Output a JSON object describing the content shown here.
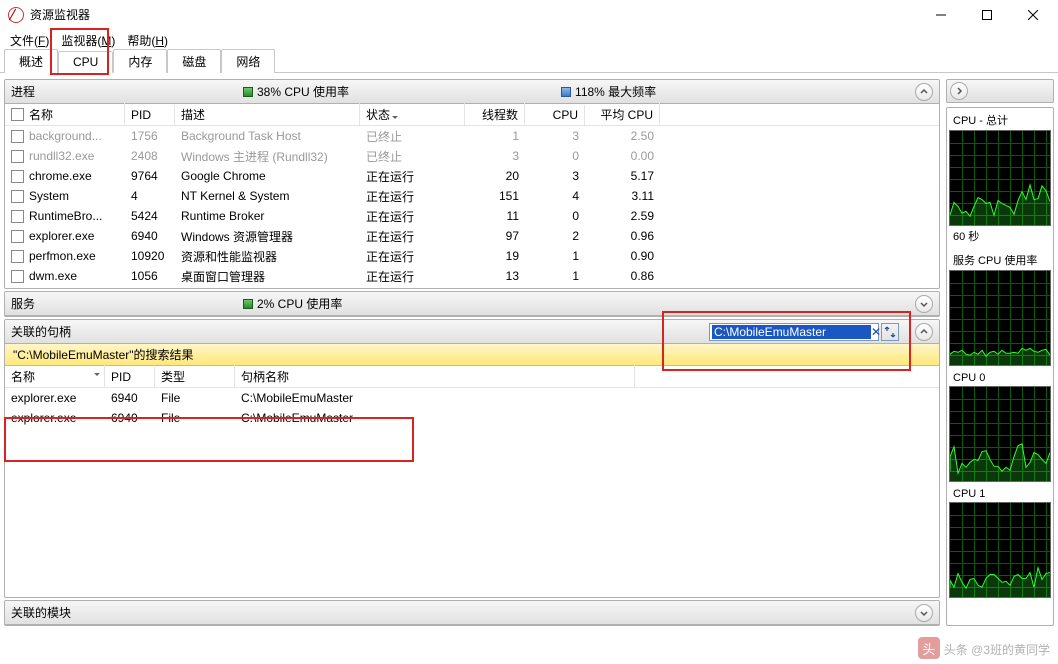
{
  "window": {
    "title": "资源监视器"
  },
  "menu": {
    "file": "文件(",
    "file_u": "F",
    "file2": ")",
    "monitor": "监视器(",
    "monitor_u": "M",
    "monitor2": ")",
    "help": "帮助(",
    "help_u": "H",
    "help2": ")"
  },
  "tabs": {
    "overview": "概述",
    "cpu": "CPU",
    "memory": "内存",
    "disk": "磁盘",
    "network": "网络"
  },
  "processes": {
    "title": "进程",
    "stat1": "38% CPU 使用率",
    "stat2": "118% 最大频率",
    "cols": {
      "name": "名称",
      "pid": "PID",
      "desc": "描述",
      "status": "状态",
      "threads": "线程数",
      "cpu": "CPU",
      "avgcpu": "平均 CPU"
    },
    "rows": [
      {
        "name": "background...",
        "pid": "1756",
        "desc": "Background Task Host",
        "status": "已终止",
        "threads": "1",
        "cpu": "3",
        "avg": "2.50",
        "gray": true
      },
      {
        "name": "rundll32.exe",
        "pid": "2408",
        "desc": "Windows 主进程 (Rundll32)",
        "status": "已终止",
        "threads": "3",
        "cpu": "0",
        "avg": "0.00",
        "gray": true
      },
      {
        "name": "chrome.exe",
        "pid": "9764",
        "desc": "Google Chrome",
        "status": "正在运行",
        "threads": "20",
        "cpu": "3",
        "avg": "5.17"
      },
      {
        "name": "System",
        "pid": "4",
        "desc": "NT Kernel & System",
        "status": "正在运行",
        "threads": "151",
        "cpu": "4",
        "avg": "3.11"
      },
      {
        "name": "RuntimeBro...",
        "pid": "5424",
        "desc": "Runtime Broker",
        "status": "正在运行",
        "threads": "11",
        "cpu": "0",
        "avg": "2.59"
      },
      {
        "name": "explorer.exe",
        "pid": "6940",
        "desc": "Windows 资源管理器",
        "status": "正在运行",
        "threads": "97",
        "cpu": "2",
        "avg": "0.96"
      },
      {
        "name": "perfmon.exe",
        "pid": "10920",
        "desc": "资源和性能监视器",
        "status": "正在运行",
        "threads": "19",
        "cpu": "1",
        "avg": "0.90"
      },
      {
        "name": "dwm.exe",
        "pid": "1056",
        "desc": "桌面窗口管理器",
        "status": "正在运行",
        "threads": "13",
        "cpu": "1",
        "avg": "0.86"
      }
    ]
  },
  "services": {
    "title": "服务",
    "stat": "2% CPU 使用率"
  },
  "handles": {
    "title": "关联的句柄",
    "search_value": "C:\\MobileEmuMaster",
    "results_label": "\"C:\\MobileEmuMaster\"的搜索结果",
    "cols": {
      "name": "名称",
      "pid": "PID",
      "type": "类型",
      "hname": "句柄名称"
    },
    "rows": [
      {
        "name": "explorer.exe",
        "pid": "6940",
        "type": "File",
        "hname": "C:\\MobileEmuMaster"
      },
      {
        "name": "explorer.exe",
        "pid": "6940",
        "type": "File",
        "hname": "C:\\MobileEmuMaster"
      }
    ]
  },
  "modules": {
    "title": "关联的模块"
  },
  "charts": {
    "total": "CPU - 总计",
    "sec": "60 秒",
    "service": "服务 CPU 使用率",
    "cpu0": "CPU 0",
    "cpu1": "CPU 1"
  },
  "watermark": "头条 @3班的黄同学"
}
